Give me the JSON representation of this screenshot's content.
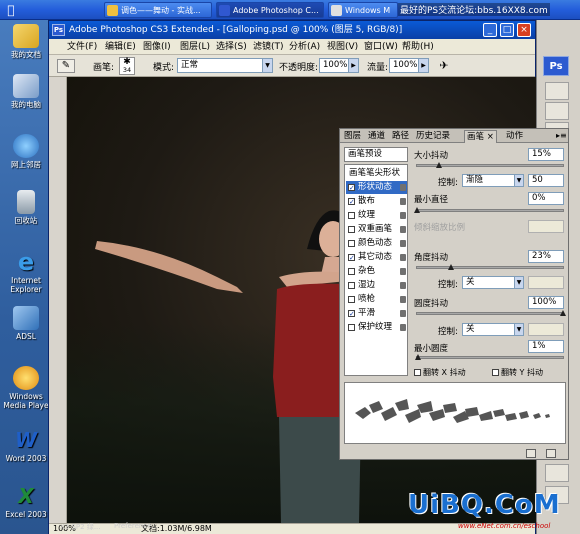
{
  "taskbar": {
    "buttons": [
      {
        "label": "调色——舞动 - 实战...",
        "active": false
      },
      {
        "label": "Adobe Photoshop C...",
        "active": true
      },
      {
        "label": "Windows M",
        "active": false
      }
    ],
    "watermark": "最好的PS交流论坛:bbs.16XX8.com"
  },
  "desktop_icons": [
    {
      "label": "我的文档",
      "icon": "my-documents-icon"
    },
    {
      "label": "我的电脑",
      "icon": "my-computer-icon"
    },
    {
      "label": "网上邻居",
      "icon": "network-places-icon"
    },
    {
      "label": "回收站",
      "icon": "recycle-bin-icon"
    },
    {
      "label": "Internet Explorer",
      "icon": "internet-explorer-icon"
    },
    {
      "label": "ADSL",
      "icon": "adsl-icon"
    },
    {
      "label": "Windows Media Playe",
      "icon": "media-player-icon"
    },
    {
      "label": "Word 2003",
      "icon": "word-icon"
    },
    {
      "label": "Excel 2003",
      "icon": "excel-icon"
    }
  ],
  "window": {
    "title": "Adobe Photoshop CS3 Extended - [Galloping.psd @ 100% (图层 5, RGB/8)]",
    "logo": "Ps"
  },
  "menubar": {
    "items": [
      "文件(F)",
      "编辑(E)",
      "图像(I)",
      "图层(L)",
      "选择(S)",
      "滤镜(T)",
      "分析(A)",
      "视图(V)",
      "窗口(W)",
      "帮助(H)"
    ]
  },
  "options": {
    "brush_label": "画笔:",
    "brush_size": "34",
    "mode_label": "模式:",
    "mode_value": "正常",
    "opacity_label": "不透明度:",
    "opacity_value": "100%",
    "flow_label": "流量:",
    "flow_value": "100%"
  },
  "right_strip": {
    "logo": "Ps"
  },
  "panel": {
    "tabs": [
      "图层",
      "通道",
      "路径",
      "历史记录",
      "画笔",
      "动作"
    ],
    "active_tab": "画笔",
    "preset_button": "画笔预设",
    "brush_list": [
      {
        "label": "画笔笔尖形状",
        "checkbox": false,
        "title": true
      },
      {
        "label": "形状动态",
        "checkbox": true,
        "checked": true,
        "selected": true
      },
      {
        "label": "散布",
        "checkbox": true,
        "checked": true
      },
      {
        "label": "纹理",
        "checkbox": true,
        "checked": false
      },
      {
        "label": "双重画笔",
        "checkbox": true,
        "checked": false
      },
      {
        "label": "颜色动态",
        "checkbox": true,
        "checked": false
      },
      {
        "label": "其它动态",
        "checkbox": true,
        "checked": true
      },
      {
        "label": "杂色",
        "checkbox": true,
        "checked": false
      },
      {
        "label": "湿边",
        "checkbox": true,
        "checked": false
      },
      {
        "label": "喷枪",
        "checkbox": true,
        "checked": false
      },
      {
        "label": "平滑",
        "checkbox": true,
        "checked": true
      },
      {
        "label": "保护纹理",
        "checkbox": true,
        "checked": false
      }
    ],
    "size_jitter_label": "大小抖动",
    "size_jitter_value": "15%",
    "size_jitter_fraction": 0.15,
    "control_label": "控制:",
    "control1_value": "渐隐",
    "control1_number": "50",
    "min_diameter_label": "最小直径",
    "min_diameter_value": "0%",
    "tilt_scale_label": "倾斜缩放比例",
    "angle_jitter_label": "角度抖动",
    "angle_jitter_value": "23%",
    "angle_jitter_fraction": 0.23,
    "control2_value": "关",
    "roundness_jitter_label": "圆度抖动",
    "roundness_jitter_value": "100%",
    "roundness_jitter_fraction": 1.0,
    "control3_value": "关",
    "min_roundness_label": "最小圆度",
    "min_roundness_value": "1%",
    "flip_x_label": "翻转 X 抖动",
    "flip_y_label": "翻转 Y 抖动"
  },
  "statusbar": {
    "zoom": "100%",
    "doc": "文档:1.03M/6.98M",
    "taskbar_hint1": "X3 SP2 绿...",
    "taskbar_hint2": "Preference..."
  },
  "watermark_bottom": {
    "big": "UiBQ.CoM",
    "small": "www.eNet.com.cn/eschool"
  }
}
